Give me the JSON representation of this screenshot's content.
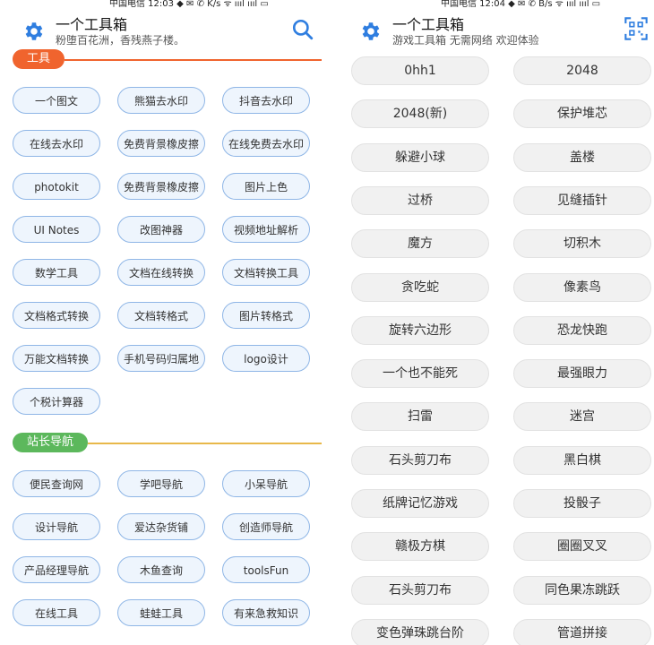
{
  "left": {
    "status_text": "中国电信 12:03 ◆ ✉ ✆  K/s  ᯤ ıııl ıııl ▭",
    "title": "一个工具箱",
    "subtitle": "粉堕百花洲，香残燕子楼。",
    "sections": [
      {
        "label": "工具",
        "color": "#f0642e",
        "items": [
          "一个图文",
          "熊猫去水印",
          "抖音去水印",
          "在线去水印",
          "免费背景橡皮擦",
          "在线免费去水印",
          "photokit",
          "免费背景橡皮擦",
          "图片上色",
          "UI Notes",
          "改图神器",
          "视频地址解析",
          "数学工具",
          "文档在线转换",
          "文档转换工具",
          "文档格式转换",
          "文档转格式",
          "图片转格式",
          "万能文档转换",
          "手机号码归属地",
          "logo设计",
          "个税计算器"
        ]
      },
      {
        "label": "站长导航",
        "color": "#5cb85c",
        "line_color": "#e8b84a",
        "items": [
          "便民查询网",
          "学吧导航",
          "小呆导航",
          "设计导航",
          "爱达杂货铺",
          "创造师导航",
          "产品经理导航",
          "木鱼查询",
          "toolsFun",
          "在线工具",
          "蛙蛙工具",
          "有来急救知识"
        ]
      }
    ]
  },
  "right": {
    "status_text": "中国电信 12:04 ◆ ✉ ✆  B/s  ᯤ ıııl ıııl ▭",
    "title": "一个工具箱",
    "subtitle": "游戏工具箱 无需网络 欢迎体验",
    "games": [
      "0hh1",
      "2048",
      "2048(新)",
      "保护堆芯",
      "躲避小球",
      "盖楼",
      "过桥",
      "见缝插针",
      "魔方",
      "切积木",
      "贪吃蛇",
      "像素鸟",
      "旋转六边形",
      "恐龙快跑",
      "一个也不能死",
      "最强眼力",
      "扫雷",
      "迷宫",
      "石头剪刀布",
      "黑白棋",
      "纸牌记忆游戏",
      "投骰子",
      "赣极方棋",
      "圈圈叉叉",
      "石头剪刀布",
      "同色果冻跳跃",
      "变色弹珠跳台阶",
      "管道拼接"
    ]
  },
  "icons": {
    "settings": "gear-icon",
    "search": "search-icon",
    "scan": "qr-scan-icon"
  },
  "colors": {
    "accent_blue": "#3b82d6",
    "chip_border": "#8fb6e6",
    "chip_bg": "#eef5fd"
  }
}
